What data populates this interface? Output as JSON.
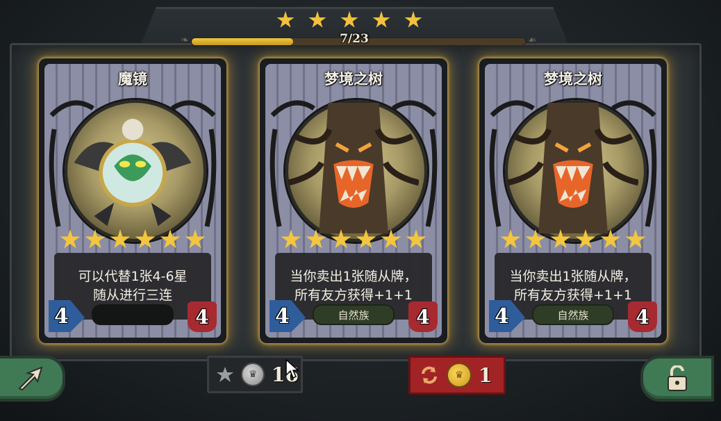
{
  "tier": {
    "stars": 5
  },
  "progress": {
    "text": "7/23",
    "current": 7,
    "total": 23
  },
  "cards": [
    {
      "name": "魔镜",
      "stars": 6,
      "desc_lines": [
        "可以代替1张4-6星",
        "随从进行三连"
      ],
      "cost": "4",
      "hp": "4",
      "tribe": "",
      "art": "magic-mirror"
    },
    {
      "name": "梦境之树",
      "stars": 6,
      "desc_lines": [
        "当你卖出1张随从牌，",
        "所有友方获得+1+1"
      ],
      "cost": "4",
      "hp": "4",
      "tribe": "自然族",
      "art": "dream-tree"
    },
    {
      "name": "梦境之树",
      "stars": 6,
      "desc_lines": [
        "当你卖出1张随从牌，",
        "所有友方获得+1+1"
      ],
      "cost": "4",
      "hp": "4",
      "tribe": "自然族",
      "art": "dream-tree"
    }
  ],
  "bottom": {
    "star_currency": "16",
    "refresh_cost": "1",
    "icons": {
      "left": "arrow-icon",
      "right": "unlock-icon",
      "star_coin": "star-icon",
      "silver": "silver-crown-coin-icon",
      "gold": "gold-crown-coin-icon",
      "refresh": "refresh-icon"
    }
  },
  "colors": {
    "gold": "#f2c23a",
    "card_glow": "#d4a032",
    "green_button": "#3f7a55",
    "refresh_red": "#a12325"
  }
}
